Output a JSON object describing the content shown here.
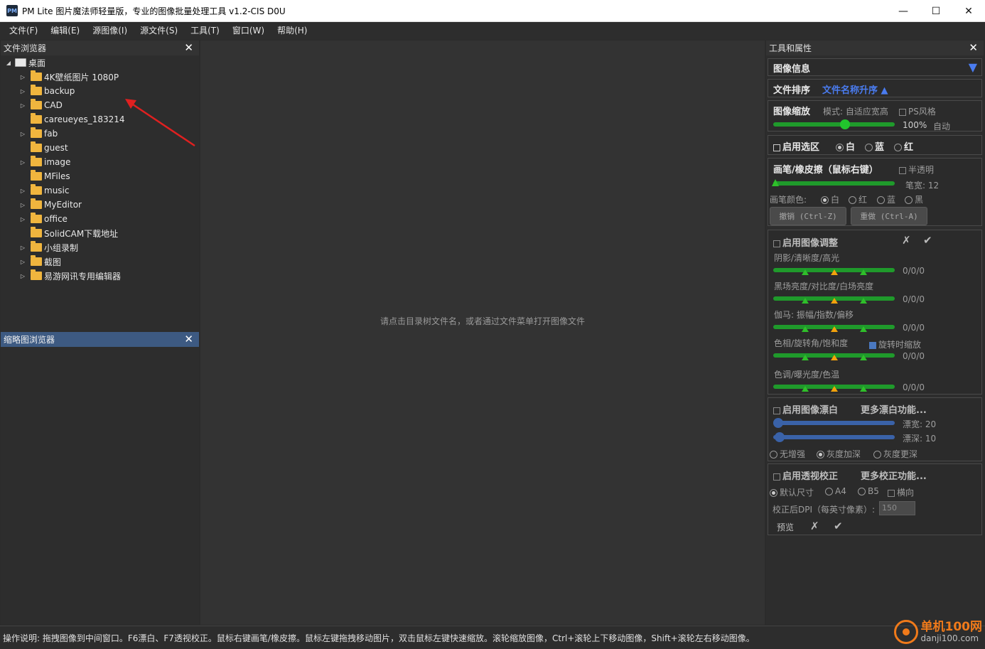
{
  "window": {
    "app_icon": "PM",
    "title": "PM Lite 图片魔法师轻量版，专业的图像批量处理工具 v1.2-CIS D0U",
    "minimize": "—",
    "maximize": "☐",
    "close": "✕"
  },
  "menu": [
    "文件(F)",
    "编辑(E)",
    "源图像(I)",
    "源文件(S)",
    "工具(T)",
    "窗口(W)",
    "帮助(H)"
  ],
  "file_browser": {
    "title": "文件浏览器",
    "close": "✕",
    "root": "桌面",
    "items": [
      {
        "label": "4K壁纸图片 1080P",
        "expandable": true
      },
      {
        "label": "backup",
        "expandable": true
      },
      {
        "label": "CAD",
        "expandable": true
      },
      {
        "label": "careueyes_183214",
        "expandable": false
      },
      {
        "label": "fab",
        "expandable": true
      },
      {
        "label": "guest",
        "expandable": false
      },
      {
        "label": "image",
        "expandable": true
      },
      {
        "label": "MFiles",
        "expandable": false
      },
      {
        "label": "music",
        "expandable": true
      },
      {
        "label": "MyEditor",
        "expandable": true
      },
      {
        "label": "office",
        "expandable": true
      },
      {
        "label": "SolidCAM下载地址",
        "expandable": false
      },
      {
        "label": "小组录制",
        "expandable": true
      },
      {
        "label": "截图",
        "expandable": true
      },
      {
        "label": "易游网讯专用编辑器",
        "expandable": true
      }
    ]
  },
  "thumbnail_browser": {
    "title": "缩略图浏览器",
    "close": "✕"
  },
  "center": {
    "hint": "请点击目录树文件名，或者通过文件菜单打开图像文件"
  },
  "tools": {
    "title": "工具和属性",
    "close": "✕",
    "image_info": {
      "label": "图像信息",
      "expand_icon": "▼"
    },
    "sort": {
      "label": "文件排序",
      "value": "文件名称升序 ▲"
    },
    "zoom": {
      "label": "图像缩放",
      "mode": "模式: 自适应宽高",
      "ps_style": "PS风格",
      "percent": "100%",
      "auto": "自动",
      "level": 0.59
    },
    "selection": {
      "label": "启用选区",
      "options": [
        "白",
        "蓝",
        "红"
      ],
      "selected": "白"
    },
    "brush": {
      "label": "画笔/橡皮擦（鼠标右键）",
      "semi_transparent": "半透明",
      "width_label": "笔宽: 12",
      "color_label": "画笔颜色:",
      "colors": [
        "白",
        "红",
        "蓝",
        "黑"
      ],
      "undo": "撤销 (Ctrl-Z)",
      "redo": "重做 (Ctrl-A)"
    },
    "adjust": {
      "label": "启用图像调整",
      "cancel": "✗",
      "apply": "✔",
      "rows": [
        {
          "label": "阴影/清晰度/高光",
          "value": "0/0/0"
        },
        {
          "label": "黑场亮度/对比度/白场亮度",
          "value": "0/0/0"
        },
        {
          "label": "伽马: 振幅/指数/偏移",
          "value": "0/0/0"
        },
        {
          "label": "色相/旋转角/饱和度",
          "value": "0/0/0"
        },
        {
          "label": "色调/曝光度/色温",
          "value": "0/0/0"
        }
      ],
      "rotate_zoom": "旋转时缩放"
    },
    "whiten": {
      "label": "启用图像漂白",
      "more": "更多漂白功能...",
      "width": "漂宽: 20",
      "depth": "漂深: 10",
      "options": [
        "无增强",
        "灰度加深",
        "灰度更深"
      ],
      "selected": "灰度加深"
    },
    "perspective": {
      "label": "启用透视校正",
      "more": "更多校正功能...",
      "options": [
        "默认尺寸",
        "A4",
        "B5"
      ],
      "landscape": "横向",
      "dpi_label": "校正后DPI（每英寸像素）:",
      "dpi_value": "150",
      "preview": "预览",
      "cancel": "✗",
      "apply": "✔"
    }
  },
  "status": {
    "text": "操作说明: 拖拽图像到中间窗口。F6漂白、F7透视校正。鼠标右键画笔/橡皮擦。鼠标左键拖拽移动图片，双击鼠标左键快速缩放。滚轮缩放图像，Ctrl+滚轮上下移动图像，Shift+滚轮左右移动图像。"
  },
  "watermark": {
    "line1": "单机100网",
    "line2": "danji100.com"
  },
  "colors": {
    "slider_green": "#1f9a2b",
    "slider_blue": "#3a62a8",
    "marker_orange": "#f2a20c",
    "accent_blue": "#4a7cf0"
  }
}
